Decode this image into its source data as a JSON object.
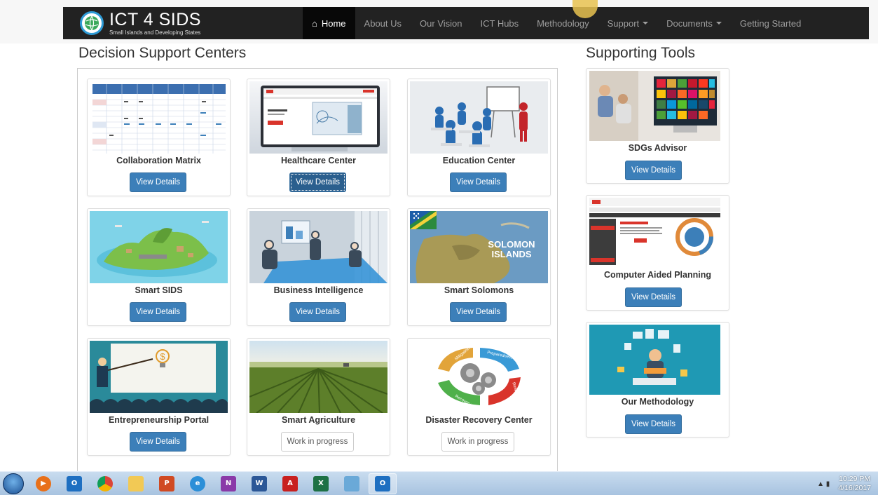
{
  "navbar": {
    "brand_title": "ICT 4 SIDS",
    "brand_subtitle": "Small Islands and Developing States",
    "items": [
      {
        "label": "Home",
        "active": true,
        "dropdown": false,
        "icon": "home-icon"
      },
      {
        "label": "About Us",
        "active": false,
        "dropdown": false
      },
      {
        "label": "Our Vision",
        "active": false,
        "dropdown": false
      },
      {
        "label": "ICT Hubs",
        "active": false,
        "dropdown": false
      },
      {
        "label": "Methodology",
        "active": false,
        "dropdown": false
      },
      {
        "label": "Support",
        "active": false,
        "dropdown": true
      },
      {
        "label": "Documents",
        "active": false,
        "dropdown": true
      },
      {
        "label": "Getting Started",
        "active": false,
        "dropdown": false
      }
    ]
  },
  "decision_support": {
    "heading": "Decision Support Centers",
    "cards": [
      {
        "title": "Collaboration Matrix",
        "button": "View Details",
        "image": "matrix-table"
      },
      {
        "title": "Healthcare Center",
        "button": "View Details",
        "image": "healthcare-monitor"
      },
      {
        "title": "Education Center",
        "button": "View Details",
        "image": "classroom-figures"
      },
      {
        "title": "Smart SIDS",
        "button": "View Details",
        "image": "island-3d"
      },
      {
        "title": "Business Intelligence",
        "button": "View Details",
        "image": "meeting-room"
      },
      {
        "title": "Smart Solomons",
        "button": "View Details",
        "image": "solomon-map"
      },
      {
        "title": "Entrepreneurship Portal",
        "button": "View Details",
        "image": "presenter-audience"
      },
      {
        "title": "Smart Agriculture",
        "button": "Work in progress",
        "image": "farm-field"
      },
      {
        "title": "Disaster Recovery Center",
        "button": "Work in progress",
        "image": "disaster-cycle"
      }
    ],
    "solomon_overlay": "SOLOMON ISLANDS",
    "cycle_labels": [
      "Mitigation",
      "Preparedness",
      "Response",
      "Recovery"
    ]
  },
  "supporting_tools": {
    "heading": "Supporting Tools",
    "cards": [
      {
        "title": "SDGs Advisor",
        "button": "View Details",
        "image": "sdg-screen"
      },
      {
        "title": "Computer Aided Planning",
        "button": "View Details",
        "image": "planning-site"
      },
      {
        "title": "Our Methodology",
        "button": "View Details",
        "image": "methodology-illustration"
      }
    ]
  },
  "taskbar": {
    "apps": [
      "media-player-icon",
      "outlook-icon",
      "chrome-icon",
      "file-explorer-icon",
      "powerpoint-icon",
      "internet-explorer-icon",
      "onenote-icon",
      "word-icon",
      "acrobat-icon",
      "excel-icon",
      "window-icon",
      "outlook-active-icon"
    ],
    "time": "10:29 PM",
    "date": "4/16/2017"
  },
  "colors": {
    "navbar_bg": "#222222",
    "primary_button": "#3c7fb9"
  }
}
